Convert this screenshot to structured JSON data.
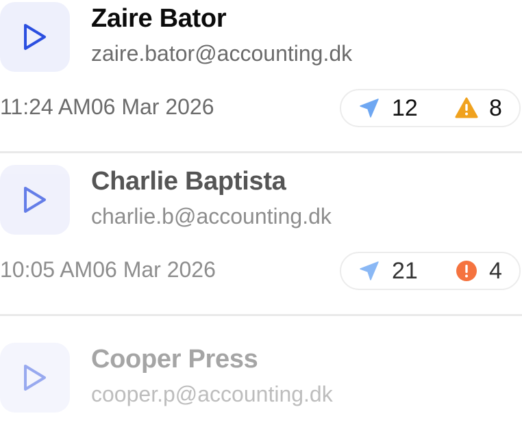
{
  "contacts": [
    {
      "name": "Zaire Bator",
      "email": "zaire.bator@accounting.dk",
      "timestamp": "11:24 AM06 Mar 2026",
      "sent_count": "12",
      "alert_count": "8",
      "alert_type": "warning-triangle",
      "alert_color": "#f0a21e"
    },
    {
      "name": "Charlie Baptista",
      "email": "charlie.b@accounting.dk",
      "timestamp": "10:05 AM06 Mar 2026",
      "sent_count": "21",
      "alert_count": "4",
      "alert_type": "error-circle",
      "alert_color": "#f5733f"
    },
    {
      "name": "Cooper Press",
      "email": "cooper.p@accounting.dk"
    }
  ],
  "icons": {
    "play": "play-icon",
    "sent": "send-arrow-icon"
  },
  "colors": {
    "play_icon": "#2b4fe0",
    "sent_icon": "#6ea7f2",
    "divider": "#e9e9e9"
  }
}
